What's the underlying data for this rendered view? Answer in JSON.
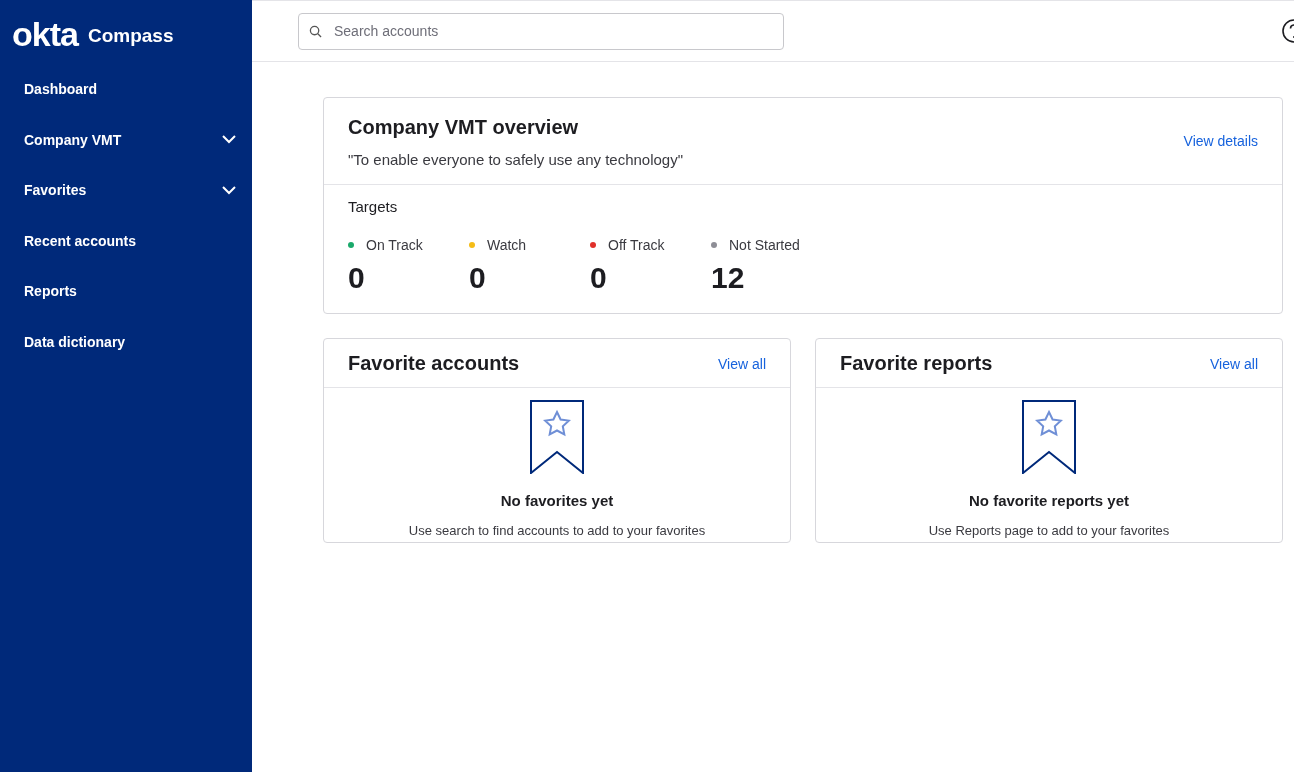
{
  "sidebar": {
    "logo": "okta",
    "product": "Compass",
    "items": [
      {
        "label": "Dashboard",
        "kind": "link"
      },
      {
        "label": "Company VMT",
        "kind": "group",
        "expanded": false
      },
      {
        "label": "Favorites",
        "kind": "group",
        "expanded": false
      },
      {
        "label": "Recent accounts",
        "kind": "link"
      },
      {
        "label": "Reports",
        "kind": "link"
      },
      {
        "label": "Data dictionary",
        "kind": "link"
      }
    ]
  },
  "header": {
    "search": {
      "placeholder": "Search accounts"
    }
  },
  "overview": {
    "title": "Company VMT overview",
    "subtitle": "\"To enable everyone to safely use any technology\"",
    "link": "View details",
    "targets_label": "Targets",
    "targets": [
      {
        "label": "On Track",
        "count": "0",
        "color": "#1aa96b"
      },
      {
        "label": "Watch",
        "count": "0",
        "color": "#f5bc16"
      },
      {
        "label": "Off Track",
        "count": "0",
        "color": "#e0302a"
      },
      {
        "label": "Not Started",
        "count": "12",
        "color": "#8e8e96"
      }
    ]
  },
  "cards": [
    {
      "title": "Favorite accounts",
      "link": "View all",
      "empty_title": "No favorites yet",
      "empty_text": "Use search to find accounts to add to your favorites"
    },
    {
      "title": "Favorite reports",
      "link": "View all",
      "empty_title": "No favorite reports yet",
      "empty_text": "Use Reports page to add to your favorites"
    }
  ]
}
